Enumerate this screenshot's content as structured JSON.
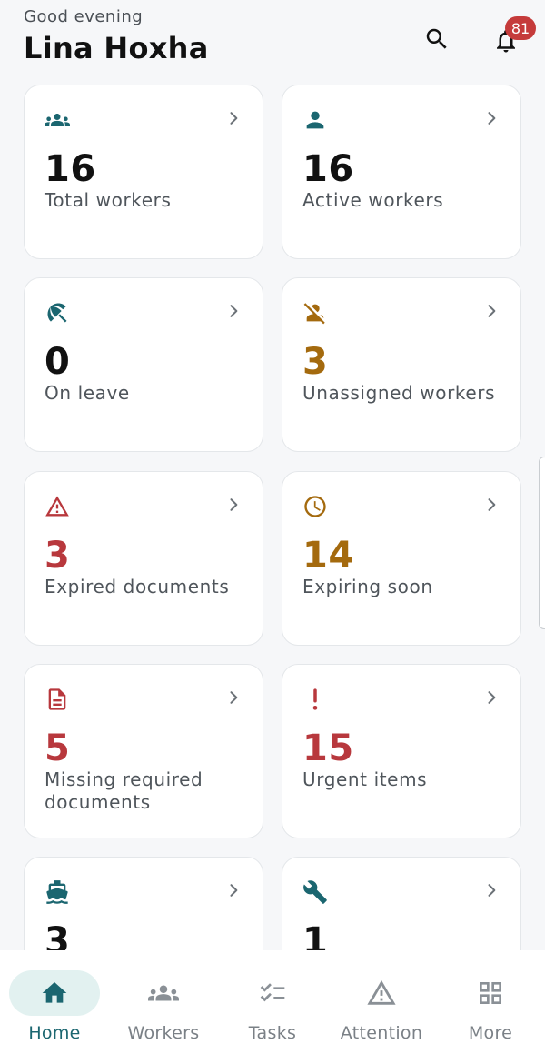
{
  "header": {
    "greeting": "Good evening",
    "user_name": "Lina Hoxha",
    "search_icon": "search-icon",
    "notification_icon": "bell-icon",
    "notification_count": "81"
  },
  "cards": [
    {
      "icon": "group-icon",
      "value": "16",
      "label": "Total workers",
      "tone": "dark"
    },
    {
      "icon": "person-icon",
      "value": "16",
      "label": "Active workers",
      "tone": "dark"
    },
    {
      "icon": "beach-umbrella-icon",
      "value": "0",
      "label": "On leave",
      "tone": "dark"
    },
    {
      "icon": "person-off-icon",
      "value": "3",
      "label": "Unassigned workers",
      "tone": "amber"
    },
    {
      "icon": "warning-icon",
      "value": "3",
      "label": "Expired documents",
      "tone": "red"
    },
    {
      "icon": "clock-icon",
      "value": "14",
      "label": "Expiring soon",
      "tone": "amber"
    },
    {
      "icon": "document-icon",
      "value": "5",
      "label": "Missing required documents",
      "tone": "red"
    },
    {
      "icon": "exclamation-icon",
      "value": "15",
      "label": "Urgent items",
      "tone": "red"
    },
    {
      "icon": "ship-icon",
      "value": "3",
      "label": "",
      "tone": "dark"
    },
    {
      "icon": "wrench-icon",
      "value": "1",
      "label": "",
      "tone": "dark"
    }
  ],
  "bottom_nav": [
    {
      "icon": "home-icon",
      "label": "Home",
      "active": true
    },
    {
      "icon": "workers-icon",
      "label": "Workers",
      "active": false
    },
    {
      "icon": "tasks-icon",
      "label": "Tasks",
      "active": false
    },
    {
      "icon": "attention-icon",
      "label": "Attention",
      "active": false
    },
    {
      "icon": "grid-icon",
      "label": "More",
      "active": false
    }
  ],
  "colors": {
    "teal": "#1b6670",
    "amber": "#a46a0e",
    "red": "#b8383d",
    "badge": "#c53b3b",
    "nav_active_bg": "#e2f1f0"
  }
}
